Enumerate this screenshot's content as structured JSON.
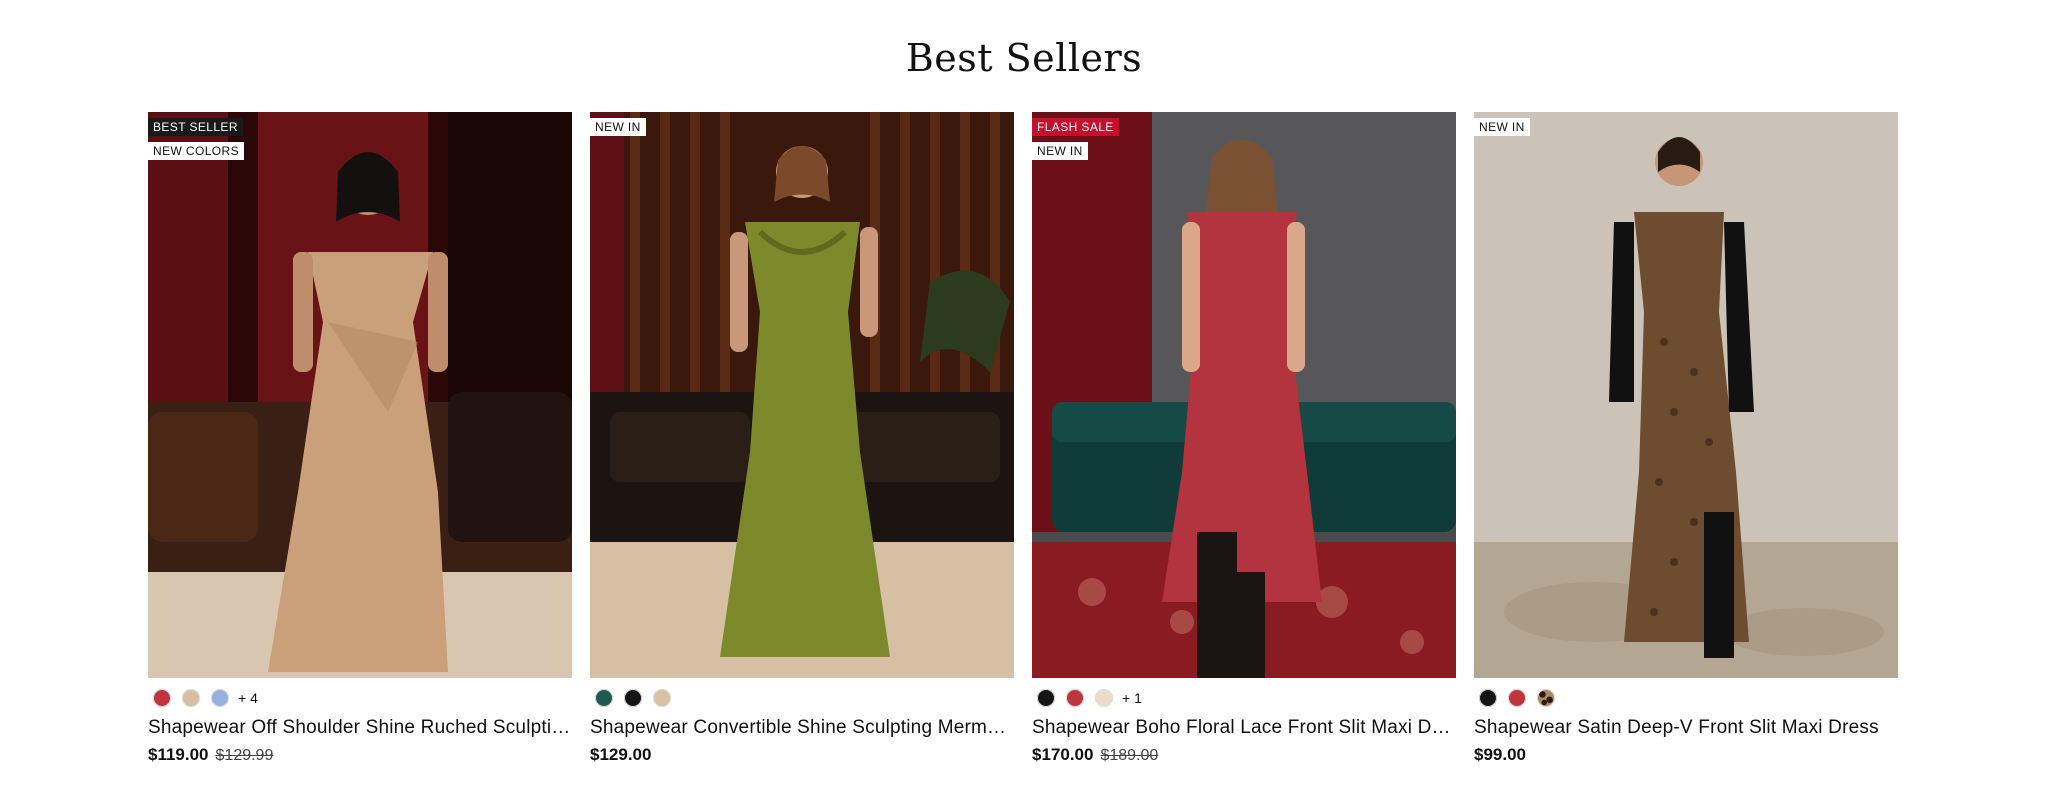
{
  "section": {
    "title": "Best Sellers"
  },
  "products": [
    {
      "badges": [
        {
          "text": "BEST SELLER",
          "style": "dark"
        },
        {
          "text": "NEW COLORS",
          "style": "light"
        }
      ],
      "swatches": [
        "#c0343f",
        "#d8bea0",
        "#98b1e0"
      ],
      "more": "+ 4",
      "name": "Shapewear Off Shoulder Shine Ruched Sculpting Maxi Dress",
      "price": "$119.00",
      "was": "$129.99",
      "colors": {
        "bg": "#3a0a0c",
        "dress": "#c9a07a",
        "floor": "#d8c6b0",
        "sofa": "#3a1f14"
      }
    },
    {
      "badges": [
        {
          "text": "NEW IN",
          "style": "light"
        }
      ],
      "swatches": [
        "#1f5a50",
        "#151515",
        "#d9c2a4"
      ],
      "more": "",
      "name": "Shapewear Convertible Shine Sculpting Mermaid Maxi Dress",
      "price": "$129.00",
      "was": "",
      "colors": {
        "bg": "#4a200f",
        "dress": "#7d8a2c",
        "floor": "#d6bfa2",
        "sofa": "#1c1410"
      }
    },
    {
      "badges": [
        {
          "text": "FLASH SALE",
          "style": "sale"
        },
        {
          "text": "NEW IN",
          "style": "light"
        }
      ],
      "swatches": [
        "#151515",
        "#c0343f",
        "#eedccb"
      ],
      "more": "+ 1",
      "name": "Shapewear Boho Floral Lace Front Slit Maxi Dress",
      "price": "$170.00",
      "was": "$189.00",
      "colors": {
        "bg": "#4a4a4c",
        "dress": "#b3333f",
        "floor": "#8a1b22",
        "sofa": "#0f3b38"
      }
    },
    {
      "badges": [
        {
          "text": "NEW IN",
          "style": "light"
        }
      ],
      "swatches": [
        "#151515",
        "#c0343f",
        "#6b4a2a"
      ],
      "more": "",
      "name": "Shapewear Satin Deep-V Front Slit Maxi Dress",
      "price": "$99.00",
      "was": "",
      "colors": {
        "bg": "#c9c0b4",
        "dress": "#6e4c2f",
        "floor": "#b7aa99",
        "sofa": "#c9c0b4"
      }
    }
  ]
}
